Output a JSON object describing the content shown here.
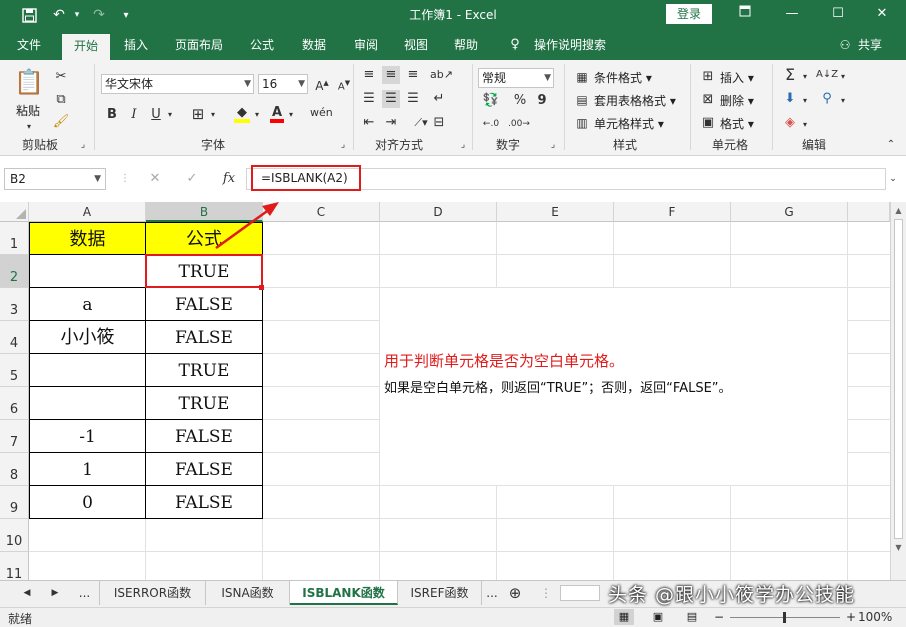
{
  "window": {
    "title": "工作簿1  -  Excel",
    "login_label": "登录"
  },
  "quick_access": [
    "save-icon",
    "undo-icon",
    "redo-icon",
    "customize-icon"
  ],
  "ribbon_tabs": [
    "文件",
    "开始",
    "插入",
    "页面布局",
    "公式",
    "数据",
    "审阅",
    "视图",
    "帮助",
    "操作说明搜索",
    "共享"
  ],
  "active_tab": "开始",
  "ribbon": {
    "clipboard": {
      "paste_label": "粘贴",
      "group_label": "剪贴板"
    },
    "font": {
      "font_name": "华文宋体",
      "font_size": "16",
      "bold": "B",
      "italic": "I",
      "underline": "U",
      "font_color_glyph": "A",
      "group_label": "字体"
    },
    "alignment": {
      "group_label": "对齐方式"
    },
    "number": {
      "format": "常规",
      "group_label": "数字"
    },
    "styles": {
      "cond_format": "条件格式",
      "table_format": "套用表格格式",
      "cell_style": "单元格样式",
      "group_label": "样式"
    },
    "cells": {
      "insert": "插入",
      "delete": "删除",
      "format": "格式",
      "group_label": "单元格"
    },
    "editing": {
      "group_label": "编辑"
    }
  },
  "formula_bar": {
    "name_box": "B2",
    "fx": "fx",
    "formula": "=ISBLANK(A2)"
  },
  "sheet": {
    "columns": [
      "A",
      "B",
      "C",
      "D",
      "E",
      "F",
      "G"
    ],
    "rows": [
      "1",
      "2",
      "3",
      "4",
      "5",
      "6",
      "7",
      "8",
      "9",
      "10",
      "11"
    ],
    "header_a": "数据",
    "header_b": "公式",
    "data": [
      {
        "a": "",
        "b": "TRUE"
      },
      {
        "a": "a",
        "b": "FALSE"
      },
      {
        "a": "小小筱",
        "b": "FALSE"
      },
      {
        "a": "",
        "b": "TRUE"
      },
      {
        "a": "",
        "b": "TRUE"
      },
      {
        "a": "-1",
        "b": "FALSE"
      },
      {
        "a": "1",
        "b": "FALSE"
      },
      {
        "a": "0",
        "b": "FALSE"
      }
    ],
    "note_title": "用于判断单元格是否为空白单元格。",
    "note_body": "如果是空白单元格，则返回“TRUE”；否则，返回“FALSE”。"
  },
  "sheet_tabs": [
    "...",
    "ISERROR函数",
    "ISNA函数",
    "ISBLANK函数",
    "ISREF函数",
    "..."
  ],
  "active_sheet": "ISBLANK函数",
  "status": {
    "ready": "就绪",
    "zoom": "100%"
  },
  "watermark": "头条 @跟小小筱学办公技能",
  "colors": {
    "excel_green": "#217346",
    "header_fill": "#ffff00",
    "highlight_red": "#e01b1b"
  }
}
